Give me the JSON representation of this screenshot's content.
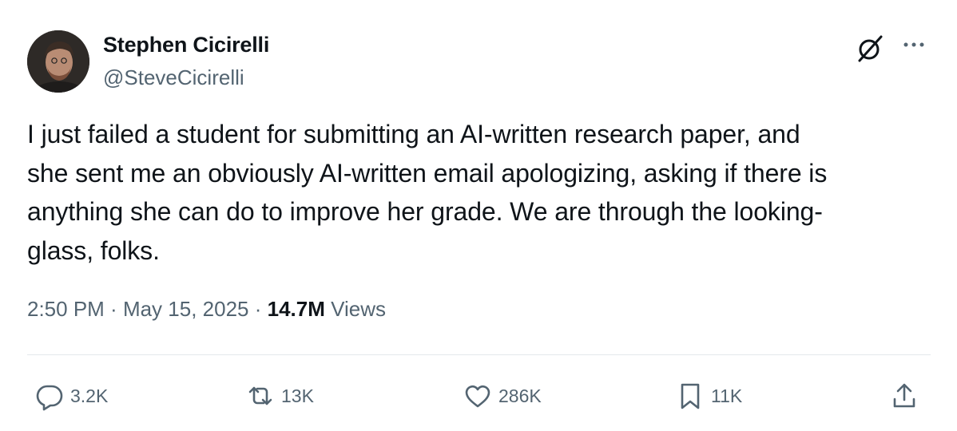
{
  "author": {
    "display_name": "Stephen Cicirelli",
    "handle": "@SteveCicirelli",
    "avatar": "profile-photo"
  },
  "tweet": {
    "lines": [
      "I just failed a student for submitting an AI-written research paper, and",
      "she sent me an obviously AI-written email apologizing, asking if there is",
      "anything she can do to improve her grade. We are through the looking-",
      "glass, folks."
    ]
  },
  "meta": {
    "time": "2:50 PM",
    "sep1": " · ",
    "date": "May 15, 2025",
    "sep2": " · ",
    "views_count": "14.7M",
    "views_label": " Views"
  },
  "actions": {
    "replies": "3.2K",
    "reposts": "13K",
    "likes": "286K",
    "bookmarks": "11K"
  },
  "icons": {
    "grok": "grok-icon",
    "more": "more-dots-icon",
    "reply": "reply-bubble-icon",
    "repost": "repost-arrows-icon",
    "like": "heart-icon",
    "bookmark": "bookmark-icon",
    "share": "share-upload-icon"
  },
  "colors": {
    "text": "#0f1419",
    "secondary": "#536471",
    "divider": "#e4e8eb"
  }
}
